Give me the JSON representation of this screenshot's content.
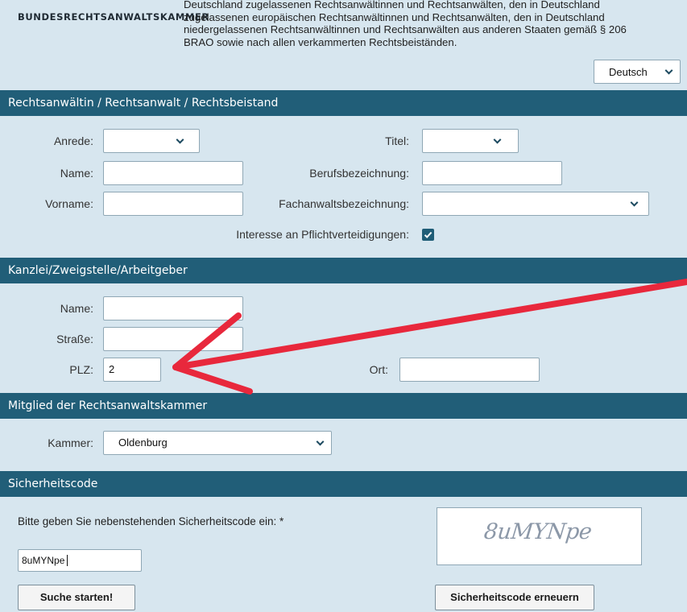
{
  "header": {
    "logo_text": "BUNDESRECHTSANWALTSKAMMER",
    "intro_lines": [
      "Deutschland zugelassenen Rechtsanwältinnen und Rechtsanwälten, den in Deutschland",
      "zugelassenen europäischen Rechtsanwältinnen und Rechtsanwälten, den in Deutschland",
      "niedergelassenen Rechtsanwältinnen und Rechtsanwälten aus anderen Staaten gemäß § 206",
      "BRAO sowie nach allen verkammerten Rechtsbeiständen."
    ],
    "language_selected": "Deutsch"
  },
  "section_lawyer": {
    "title": "Rechtsanwältin / Rechtsanwalt / Rechtsbeistand",
    "anrede_label": "Anrede:",
    "anrede_value": "",
    "titel_label": "Titel:",
    "titel_value": "",
    "name_label": "Name:",
    "name_value": "",
    "berufsbezeichnung_label": "Berufsbezeichnung:",
    "berufsbezeichnung_value": "",
    "vorname_label": "Vorname:",
    "vorname_value": "",
    "fachanwalt_label": "Fachanwaltsbezeichnung:",
    "fachanwalt_value": "",
    "pflicht_label": "Interesse an Pflichtverteidigungen:",
    "pflicht_checked": true
  },
  "section_kanzlei": {
    "title": "Kanzlei/Zweigstelle/Arbeitgeber",
    "name_label": "Name:",
    "name_value": "",
    "strasse_label": "Straße:",
    "strasse_value": "",
    "plz_label": "PLZ:",
    "plz_value": "2",
    "ort_label": "Ort:",
    "ort_value": ""
  },
  "section_kammer": {
    "title": "Mitglied der Rechtsanwaltskammer",
    "kammer_label": "Kammer:",
    "kammer_value": "Oldenburg"
  },
  "section_captcha": {
    "title": "Sicherheitscode",
    "prompt": "Bitte geben Sie nebenstehenden Sicherheitscode ein: *",
    "captcha_image_text": "8uMYNpe",
    "input_value": "8uMYNpe",
    "search_button": "Suche starten!",
    "renew_button": "Sicherheitscode erneuern"
  },
  "annotation": {
    "arrow_color": "#e8283c"
  }
}
